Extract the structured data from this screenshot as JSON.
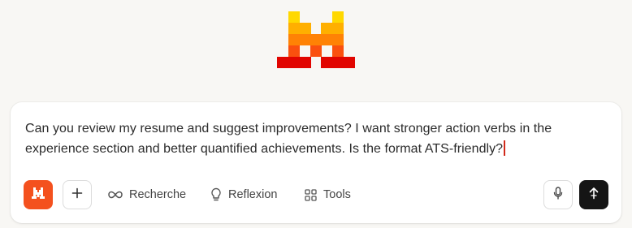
{
  "composer": {
    "text": "Can you review my resume and suggest improvements? I want stronger action verbs in the experience section and better quantified achievements. Is the format ATS-friendly?",
    "brand_color": "#f4511e"
  },
  "toolbar": {
    "brand_icon": "mistral-m-icon",
    "add_icon": "plus-icon",
    "search_label": "Recherche",
    "search_icon": "infinity-icon",
    "reflect_label": "Reflexion",
    "reflect_icon": "lightbulb-icon",
    "tools_label": "Tools",
    "tools_icon": "grid-icon",
    "mic_icon": "microphone-icon",
    "send_icon": "arrow-up-icon"
  },
  "logo": {
    "icon": "mistral-logo-icon",
    "colors": [
      "#ffd800",
      "#ffaf00",
      "#ff8205",
      "#fa500f",
      "#e10500"
    ]
  }
}
